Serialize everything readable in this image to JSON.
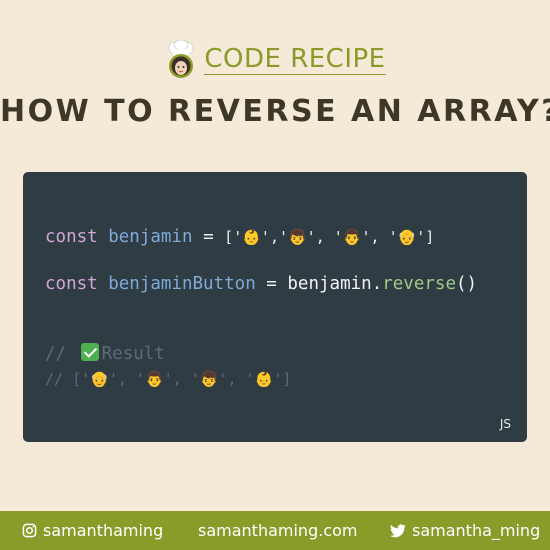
{
  "brand": {
    "title": "CODE RECIPE",
    "icon": "chef-avatar-icon"
  },
  "headline": "HOW TO REVERSE AN ARRAY?",
  "code": {
    "keyword": "const",
    "var1": "benjamin",
    "array_literal": "['👶','👦', '👨', '👴']",
    "var2": "benjaminButton",
    "assign": "=",
    "obj": "benjamin",
    "method": "reverse",
    "comment_slashes": "//",
    "comment_result": "Result",
    "comment_output": "// ['👴', '👨', '👦', '👶']",
    "lang": "JS"
  },
  "footer": {
    "instagram": "samanthaming",
    "website": "samanthaming.com",
    "twitter": "samantha_ming"
  },
  "colors": {
    "background": "#f5e9d8",
    "accent": "#8a9b2a",
    "code_bg": "#2f3c43",
    "headline": "#3c3726"
  }
}
